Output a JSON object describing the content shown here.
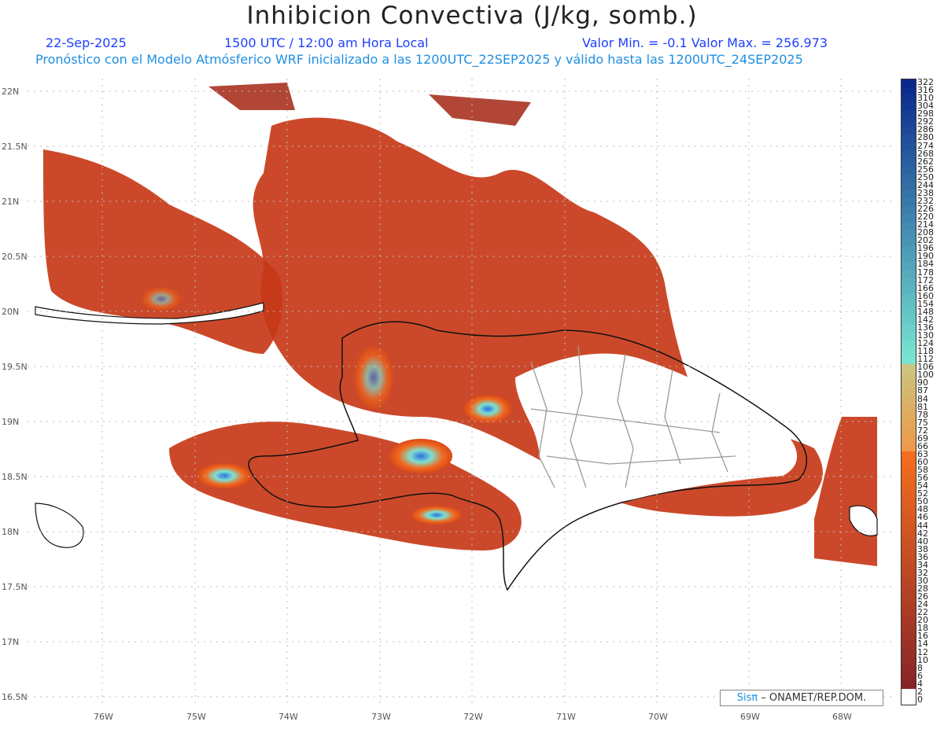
{
  "title": "Inhibicion Convectiva (J/kg, somb.)",
  "header": {
    "date": "22-Sep-2025",
    "time": "1500 UTC / 12:00 am Hora Local",
    "minmax": "Valor Min. = -0.1  Valor Max. = 256.973",
    "subtitle": "Pronóstico con el Modelo Atmósferico WRF inicializado a las 1200UTC_22SEP2025 y válido hasta las  1200UTC_24SEP2025"
  },
  "axes": {
    "lat_labels": [
      "22N",
      "21.5N",
      "21N",
      "20.5N",
      "20N",
      "19.5N",
      "19N",
      "18.5N",
      "18N",
      "17.5N",
      "17N",
      "16.5N"
    ],
    "lon_labels": [
      "76W",
      "75W",
      "74W",
      "73W",
      "72W",
      "71W",
      "70W",
      "69W",
      "68W"
    ]
  },
  "legend": {
    "labels": [
      "322",
      "316",
      "310",
      "304",
      "298",
      "292",
      "286",
      "280",
      "274",
      "268",
      "262",
      "256",
      "250",
      "244",
      "238",
      "232",
      "226",
      "220",
      "214",
      "208",
      "202",
      "196",
      "190",
      "184",
      "178",
      "172",
      "166",
      "160",
      "154",
      "148",
      "142",
      "136",
      "130",
      "124",
      "118",
      "112",
      "106",
      "100",
      "90",
      "87",
      "84",
      "81",
      "78",
      "75",
      "72",
      "69",
      "66",
      "63",
      "60",
      "58",
      "56",
      "54",
      "52",
      "50",
      "48",
      "46",
      "44",
      "42",
      "40",
      "38",
      "36",
      "34",
      "32",
      "30",
      "28",
      "26",
      "24",
      "22",
      "20",
      "18",
      "16",
      "14",
      "12",
      "10",
      "8",
      "6",
      "4",
      "2",
      "0"
    ]
  },
  "credit": {
    "sis": "Sisπ",
    "text": "– ONAMET/REP.DOM."
  },
  "colors": {
    "dark": "#8e2c22",
    "mid": "#d84a18",
    "orange": "#f06a20",
    "cyan": "#7ee0d0",
    "blue": "#2a6fe0"
  }
}
